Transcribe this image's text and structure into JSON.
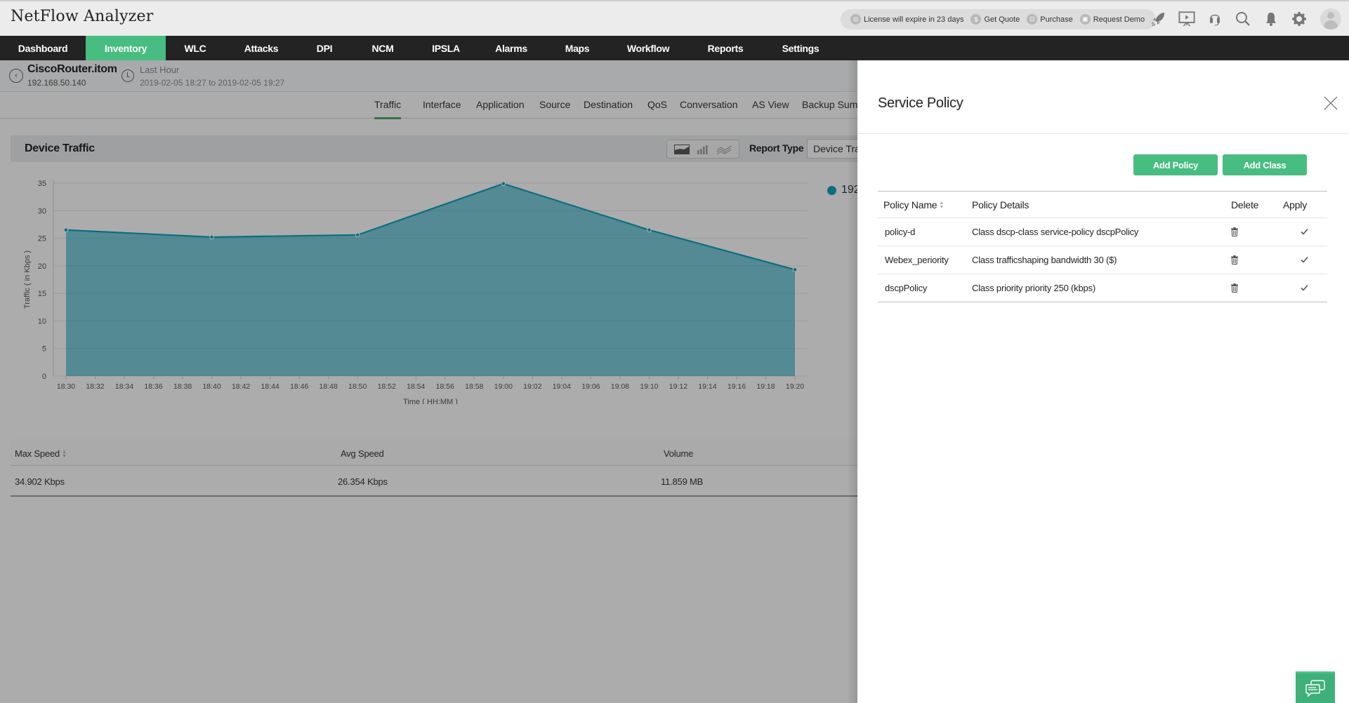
{
  "app": {
    "title": "NetFlow Analyzer"
  },
  "header": {
    "license_text": "License will expire in 23 days",
    "get_quote": "Get Quote",
    "purchase": "Purchase",
    "request_demo": "Request Demo",
    "icons": [
      "rocket-icon",
      "presentation-icon",
      "headset-icon",
      "search-icon",
      "bell-icon",
      "gear-icon",
      "avatar"
    ]
  },
  "nav": {
    "items": [
      {
        "label": "Dashboard",
        "active": false
      },
      {
        "label": "Inventory",
        "active": true
      },
      {
        "label": "WLC",
        "active": false
      },
      {
        "label": "Attacks",
        "active": false
      },
      {
        "label": "DPI",
        "active": false
      },
      {
        "label": "NCM",
        "active": false
      },
      {
        "label": "IPSLA",
        "active": false
      },
      {
        "label": "Alarms",
        "active": false
      },
      {
        "label": "Maps",
        "active": false
      },
      {
        "label": "Workflow",
        "active": false
      },
      {
        "label": "Reports",
        "active": false
      },
      {
        "label": "Settings",
        "active": false
      }
    ]
  },
  "device": {
    "name": "CiscoRouter.itom",
    "ip": "192.168.50.140",
    "period": "Last Hour",
    "range": "2019-02-05 18:27 to 2019-02-05 19:27"
  },
  "tabs": [
    {
      "label": "Traffic",
      "active": true
    },
    {
      "label": "Interface"
    },
    {
      "label": "Application"
    },
    {
      "label": "Source"
    },
    {
      "label": "Destination"
    },
    {
      "label": "QoS"
    },
    {
      "label": "Conversation"
    },
    {
      "label": "AS View"
    },
    {
      "label": "Backup Summ"
    }
  ],
  "panel": {
    "title": "Device Traffic",
    "report_type_label": "Report Type",
    "report_type_value": "Device Traffic"
  },
  "legend": {
    "label": "192"
  },
  "chart_data": {
    "type": "area",
    "title": "",
    "xlabel": "Time ( HH:MM )",
    "ylabel": "Traffic ( in Kbps )",
    "ylim": [
      0,
      35
    ],
    "yticks": [
      0,
      5,
      10,
      15,
      20,
      25,
      30,
      35
    ],
    "xticks": [
      "18:30",
      "18:32",
      "18:34",
      "18:36",
      "18:38",
      "18:40",
      "18:42",
      "18:44",
      "18:46",
      "18:48",
      "18:50",
      "18:52",
      "18:54",
      "18:56",
      "18:58",
      "19:00",
      "19:02",
      "19:04",
      "19:06",
      "19:08",
      "19:10",
      "19:12",
      "19:14",
      "19:16",
      "19:18",
      "19:20"
    ],
    "grid": true,
    "series": [
      {
        "name": "192",
        "color": "#0f9bb5",
        "x": [
          "18:30",
          "18:40",
          "18:50",
          "19:00",
          "19:10",
          "19:20"
        ],
        "values": [
          26.5,
          25.2,
          25.6,
          34.9,
          26.5,
          19.3
        ]
      }
    ]
  },
  "stats": {
    "headers": [
      "Max Speed",
      "Avg Speed",
      "Volume"
    ],
    "values": [
      "34.902 Kbps",
      "26.354 Kbps",
      "11.859 MB"
    ]
  },
  "service_policy": {
    "title": "Service Policy",
    "add_policy": "Add Policy",
    "add_class": "Add Class",
    "columns": [
      "Policy Name",
      "Policy Details",
      "Delete",
      "Apply"
    ],
    "rows": [
      {
        "name": "policy-d",
        "details": "Class dscp-class service-policy dscpPolicy"
      },
      {
        "name": "Webex_periority",
        "details": "Class trafficshaping bandwidth 30 ($)"
      },
      {
        "name": "dscpPolicy",
        "details": "Class priority priority 250 (kbps)"
      }
    ]
  },
  "colors": {
    "accent": "#48bd81",
    "nav_bg": "#232323",
    "series": "#0f9bb5"
  }
}
